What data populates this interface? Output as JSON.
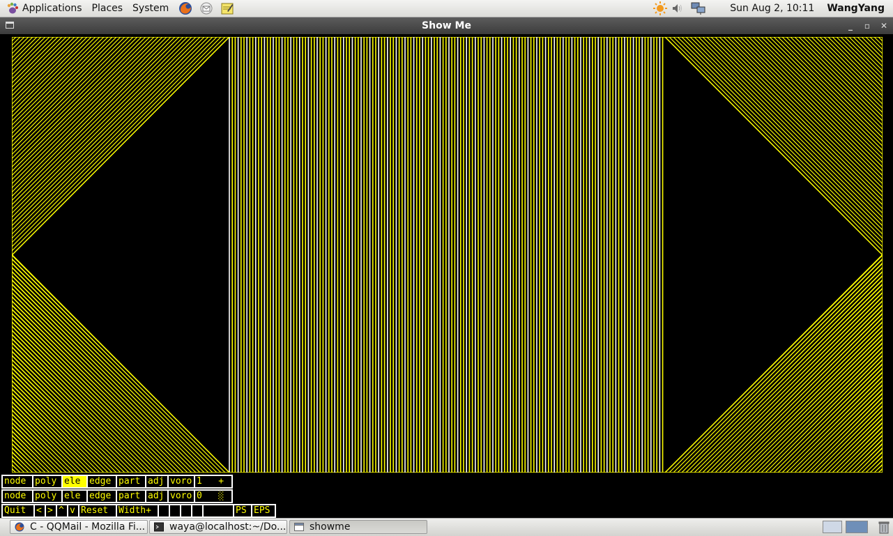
{
  "top_panel": {
    "menus": [
      "Applications",
      "Places",
      "System"
    ],
    "launchers": [
      "firefox-icon",
      "mail-icon",
      "notes-icon"
    ],
    "tray_icons": [
      "weather-sun-icon",
      "volume-icon",
      "network-icon"
    ],
    "clock": "Sun Aug  2, 10:11",
    "user": "WangYang"
  },
  "window": {
    "title": "Show Me",
    "controls": [
      "minimize-icon",
      "maximize-icon",
      "close-icon"
    ]
  },
  "canvas": {
    "line_color": "#ffff00",
    "fill_color": "#ffffff",
    "background": "#000000"
  },
  "controls": {
    "row1": [
      "node",
      "poly",
      "ele",
      "edge",
      "part",
      "adj",
      "voro",
      "1   +"
    ],
    "row2": [
      "node",
      "poly",
      "ele",
      "edge",
      "part",
      "adj",
      "voro",
      "0   ░"
    ],
    "row3": [
      "Quit",
      "<",
      ">",
      "^",
      "v",
      "Reset",
      "Width+",
      "",
      "",
      "",
      "",
      "",
      "PS",
      "EPS"
    ],
    "active_row1": "ele"
  },
  "taskbar": {
    "tasks": [
      {
        "label": "C - QQMail - Mozilla Fi...",
        "icon": "firefox-icon"
      },
      {
        "label": "waya@localhost:~/Do...",
        "icon": "terminal-icon"
      },
      {
        "label": "showme",
        "icon": "window-icon"
      }
    ]
  },
  "colors": {
    "accent_yellow": "#ffff00",
    "titlebar": "#4a4a4a",
    "panel": "#e6e6e3"
  }
}
